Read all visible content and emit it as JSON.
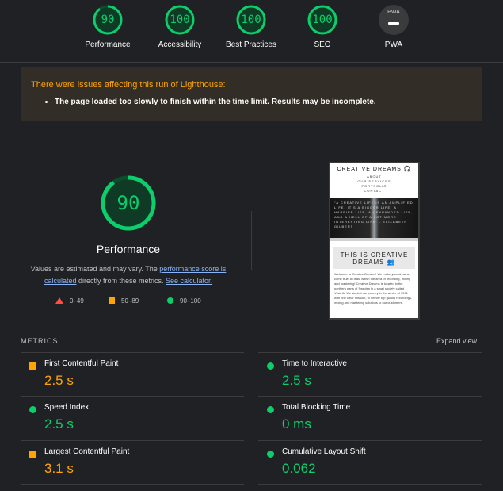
{
  "summary": {
    "gauges": [
      {
        "label": "Performance",
        "score": "90"
      },
      {
        "label": "Accessibility",
        "score": "100"
      },
      {
        "label": "Best Practices",
        "score": "100"
      },
      {
        "label": "SEO",
        "score": "100"
      }
    ],
    "pwa": {
      "label": "PWA",
      "badge": "PWA"
    }
  },
  "warning": {
    "title": "There were issues affecting this run of Lighthouse:",
    "item": "The page loaded too slowly to finish within the time limit. Results may be incomplete."
  },
  "performance": {
    "score": "90",
    "title": "Performance",
    "desc_prefix": "Values are estimated and may vary. The ",
    "desc_link1": "performance score is calculated",
    "desc_mid": " directly from these metrics. ",
    "desc_link2": "See calculator.",
    "legend": {
      "fail": "0–49",
      "average": "50–89",
      "pass": "90–100"
    }
  },
  "screenshot": {
    "brand": "CREATIVE DREAMS 🎧",
    "nav": [
      "ABOUT",
      "OUR SERVICES",
      "PORTFOLIO",
      "CONTACT"
    ],
    "quote": "\"A CREATIVE LIFE IS AN AMPLIFIED LIFE. IT'S A BIGGER LIFE, A HAPPIER LIFE, AN EXPANDED LIFE, AND A HELL OF A LOT MORE INTERESTING LIFE\" - ELIZABETH GILBERT",
    "box_title": "THIS IS CREATIVE DREAMS 👥",
    "para": "Welcome to Creative Dreams! We make your dreams come true! At least within the area of recording, mixing and mastering! Creative Dreams is located in the northern parts of Sweden in a small society called Vilstetb. We started our journey in the winter of 1991 with one clear mission, to deliver top quality recordings, mixing and mastering solutions to our customers."
  },
  "metrics": {
    "heading": "METRICS",
    "expand": "Expand view",
    "items": [
      {
        "name": "First Contentful Paint",
        "value": "2.5 s",
        "status": "average"
      },
      {
        "name": "Time to Interactive",
        "value": "2.5 s",
        "status": "pass"
      },
      {
        "name": "Speed Index",
        "value": "2.5 s",
        "status": "pass"
      },
      {
        "name": "Total Blocking Time",
        "value": "0 ms",
        "status": "pass"
      },
      {
        "name": "Largest Contentful Paint",
        "value": "3.1 s",
        "status": "average"
      },
      {
        "name": "Cumulative Layout Shift",
        "value": "0.062",
        "status": "pass"
      }
    ]
  },
  "colors": {
    "pass": "#0cce6b",
    "average": "#ffa400",
    "fail": "#ff4e42",
    "background": "#202124"
  }
}
